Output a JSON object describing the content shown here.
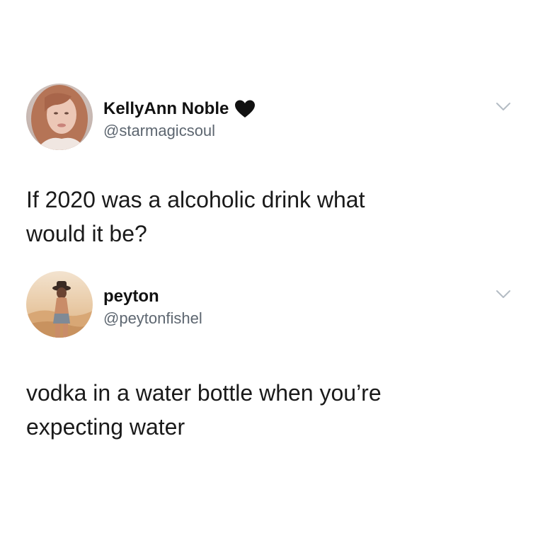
{
  "tweets": [
    {
      "display_name": "KellyAnn Noble",
      "handle": "@starmagicsoul",
      "badge_icon": "black-heart-icon",
      "menu_icon": "chevron-down-icon",
      "text": "If 2020 was a alcoholic drink what\nwould it be?"
    },
    {
      "display_name": "peyton",
      "handle": "@peytonfishel",
      "menu_icon": "chevron-down-icon",
      "text": "vodka in a water bottle when you’re\nexpecting water"
    }
  ],
  "colors": {
    "text": "#1a1a1a",
    "handle": "#5d6670",
    "chevron": "#b4bcc4",
    "heart": "#111111"
  }
}
